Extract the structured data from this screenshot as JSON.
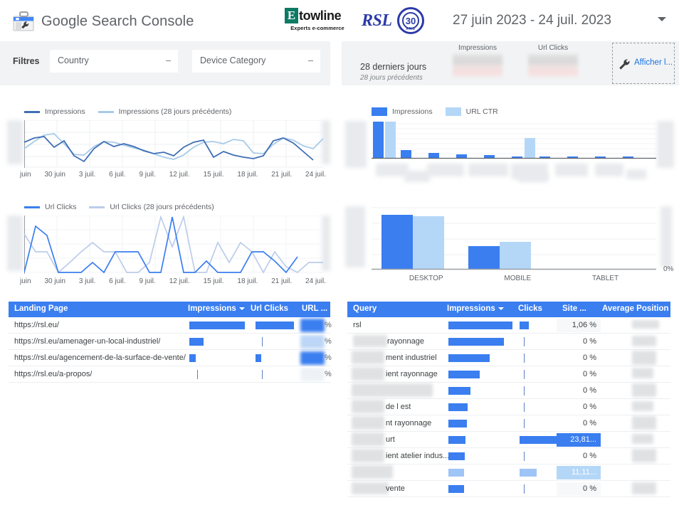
{
  "header": {
    "app_title": "Google Search Console",
    "gsc_icon": "search-console-toolbox-icon",
    "etowline": {
      "mark": "E",
      "word": "towline",
      "tagline": "Experts e-commerce"
    },
    "rsl": {
      "text": "RSL",
      "badge_number": "30",
      "badge_sub": "ANS"
    },
    "date_range": "27 juin 2023 - 24 juil. 2023",
    "date_caret_icon": "chevron-down-icon"
  },
  "filters": {
    "label": "Filtres",
    "selects": [
      {
        "value": "Country",
        "caret_icon": "chevron-down-icon"
      },
      {
        "value": "Device Category",
        "caret_icon": "chevron-down-icon"
      }
    ]
  },
  "kpis": {
    "period": "28 derniers jours",
    "period_prev": "28 jours précédents",
    "cards": [
      {
        "name": "Impressions",
        "value": ""
      },
      {
        "name": "Url Clicks",
        "value": ""
      }
    ],
    "show_button": {
      "label": "Afficher l...",
      "icon": "wrench-icon"
    }
  },
  "chart_data": [
    {
      "id": "impressions-timeseries",
      "type": "line",
      "title": "",
      "legend": [
        {
          "name": "Impressions",
          "color": "#3f6fb5"
        },
        {
          "name": "Impressions (28 jours précédents)",
          "color": "#a8cbe8"
        }
      ],
      "legend_position": "top-left",
      "xlabel": "",
      "ylabel": "",
      "grid": true,
      "ylim": [
        0,
        100
      ],
      "tick_labels": [
        "juin",
        "30 juin",
        "3 juil.",
        "6 juil.",
        "9 juil.",
        "12 juil.",
        "15 juil.",
        "18 juil.",
        "21 juil.",
        "24 juil."
      ],
      "x": [
        0,
        1,
        2,
        3,
        4,
        5,
        6,
        7,
        8,
        9,
        10,
        11,
        12,
        13,
        14,
        15,
        16,
        17,
        18,
        19,
        20,
        21,
        22,
        23,
        24,
        25,
        26,
        27
      ],
      "series": [
        {
          "name": "Impressions",
          "color": "#3f6fb5",
          "values": [
            62,
            70,
            72,
            52,
            66,
            38,
            24,
            46,
            60,
            50,
            56,
            50,
            42,
            38,
            40,
            34,
            52,
            62,
            66,
            30,
            40,
            34,
            30,
            28,
            32,
            62,
            68,
            58,
            40,
            22
          ]
        },
        {
          "name": "Impressions (28 jours précédents)",
          "color": "#a8cbe8",
          "values": [
            50,
            62,
            72,
            74,
            56,
            34,
            32,
            48,
            58,
            56,
            52,
            46,
            42,
            36,
            30,
            26,
            34,
            50,
            60,
            60,
            56,
            64,
            62,
            36,
            34,
            54,
            66,
            62,
            52,
            46,
            62
          ]
        }
      ]
    },
    {
      "id": "urlclicks-timeseries",
      "type": "line",
      "title": "",
      "legend": [
        {
          "name": "Url Clicks",
          "color": "#3a7ef0"
        },
        {
          "name": "Url Clicks (28 jours précédents)",
          "color": "#bcccea"
        }
      ],
      "legend_position": "top-left",
      "xlabel": "",
      "ylabel": "",
      "grid": true,
      "ylim": [
        0,
        100
      ],
      "tick_labels": [
        "juin",
        "30 juin",
        "3 juil.",
        "6 juil.",
        "9 juil.",
        "12 juil.",
        "15 juil.",
        "18 juil.",
        "21 juil.",
        "24 juil."
      ],
      "series": [
        {
          "name": "Url Clicks",
          "color": "#3a7ef0",
          "values": [
            0,
            84,
            70,
            0,
            0,
            0,
            18,
            0,
            36,
            36,
            36,
            0,
            0,
            100,
            0,
            0,
            20,
            0,
            0,
            0,
            36,
            36,
            20,
            0,
            24,
            0
          ]
        },
        {
          "name": "Url Clicks (28 jours précédents)",
          "color": "#bcccea",
          "values": [
            68,
            36,
            36,
            0,
            18,
            36,
            52,
            36,
            36,
            0,
            0,
            20,
            100,
            56,
            100,
            0,
            0,
            52,
            20,
            52,
            36,
            0,
            36,
            10,
            0,
            18
          ]
        }
      ]
    },
    {
      "id": "impressions-ctr-bars",
      "type": "bar",
      "title": "",
      "legend": [
        {
          "name": "Impressions",
          "color": "#3a7ef0"
        },
        {
          "name": "URL CTR",
          "color": "#b4d7f8"
        }
      ],
      "legend_position": "top-left",
      "categories": [
        "1",
        "2",
        "3",
        "4",
        "5",
        "6",
        "7",
        "8",
        "9",
        "10"
      ],
      "grid": true,
      "series": [
        {
          "name": "Impressions",
          "color": "#3a7ef0",
          "values": [
            100,
            22,
            14,
            9,
            6,
            3,
            2.5,
            2,
            2,
            1.5
          ]
        },
        {
          "name": "URL CTR",
          "color": "#b4d7f8",
          "values": [
            100,
            0,
            0,
            0,
            0,
            48,
            0,
            0,
            0,
            0
          ]
        }
      ]
    },
    {
      "id": "device-category-bars",
      "type": "bar",
      "title": "",
      "categories": [
        "DESKTOP",
        "MOBILE",
        "TABLET"
      ],
      "grid": true,
      "axis_right_label": "0%",
      "series": [
        {
          "name": "Impressions",
          "color": "#3a7ef0",
          "values": [
            100,
            33,
            0
          ]
        },
        {
          "name": "URL CTR",
          "color": "#b4d7f8",
          "values": [
            97,
            45,
            0
          ]
        }
      ]
    }
  ],
  "landing_table": {
    "columns": [
      {
        "label": "Landing Page",
        "sorted": false
      },
      {
        "label": "Impressions",
        "sorted": true,
        "caret_icon": "sort-desc-icon"
      },
      {
        "label": "Url Clicks",
        "sorted": false
      },
      {
        "label": "URL ...",
        "sorted": false
      }
    ],
    "rows": [
      {
        "page": "https://rsl.eu/",
        "impressions_w": 68,
        "clicks_w": 58,
        "clicks_tick": false,
        "ctr_suffix": "%"
      },
      {
        "page": "https://rsl.eu/amenager-un-local-industriel/",
        "impressions_w": 18,
        "clicks_w": 0,
        "clicks_tick": true,
        "ctr_suffix": "%"
      },
      {
        "page": "https://rsl.eu/agencement-de-la-surface-de-vente/",
        "impressions_w": 7,
        "clicks_w": 7,
        "clicks_tick": false,
        "ctr_suffix": "%"
      },
      {
        "page": "https://rsl.eu/a-propos/",
        "impressions_w": 0,
        "clicks_w": 0,
        "clicks_tick": true,
        "ctr_suffix": "%"
      }
    ]
  },
  "query_table": {
    "columns": [
      {
        "label": "Query",
        "sorted": false
      },
      {
        "label": "Impressions",
        "sorted": true,
        "caret_icon": "sort-desc-icon"
      },
      {
        "label": "Clicks",
        "sorted": false
      },
      {
        "label": "Site ...",
        "sorted": false
      },
      {
        "label": "Average Position",
        "sorted": false
      }
    ],
    "rows": [
      {
        "query": "rsl",
        "redacted_w": 0,
        "impressions_w": 92,
        "clicks_w": 13,
        "clicks_tick": false,
        "ctr": "1,06 %",
        "ctr_fill": "none"
      },
      {
        "query": "rayonnage",
        "redacted_w": 48,
        "impressions_w": 80,
        "clicks_w": 0,
        "clicks_tick": true,
        "ctr": "0 %",
        "ctr_fill": "none"
      },
      {
        "query": "ment industriel",
        "redacted_w": 44,
        "impressions_w": 58,
        "clicks_w": 0,
        "clicks_tick": true,
        "ctr": "0 %",
        "ctr_fill": "none"
      },
      {
        "query": "ient rayonnage",
        "redacted_w": 44,
        "impressions_w": 44,
        "clicks_w": 0,
        "clicks_tick": true,
        "ctr": "0 %",
        "ctr_fill": "none"
      },
      {
        "query": "",
        "redacted_w": 112,
        "impressions_w": 31,
        "clicks_w": 0,
        "clicks_tick": true,
        "ctr": "0 %",
        "ctr_fill": "none"
      },
      {
        "query": "de l est",
        "redacted_w": 44,
        "impressions_w": 27,
        "clicks_w": 0,
        "clicks_tick": true,
        "ctr": "0 %",
        "ctr_fill": "none"
      },
      {
        "query": "nt rayonnage",
        "redacted_w": 44,
        "impressions_w": 26,
        "clicks_w": 0,
        "clicks_tick": true,
        "ctr": "0 %",
        "ctr_fill": "none"
      },
      {
        "query": "urt",
        "redacted_w": 44,
        "impressions_w": 24,
        "clicks_w": 53,
        "clicks_tick": false,
        "ctr": "23,81...",
        "ctr_fill": "solid"
      },
      {
        "query": "ient atelier indus...",
        "redacted_w": 44,
        "impressions_w": 23,
        "clicks_w": 0,
        "clicks_tick": true,
        "ctr": "0 %",
        "ctr_fill": "none"
      },
      {
        "query": "",
        "redacted_w": 56,
        "impressions_w": 22,
        "clicks_w": 24,
        "clicks_tick": false,
        "ctr": "11,11...",
        "ctr_fill": "light"
      },
      {
        "query": "vente",
        "redacted_w": 48,
        "impressions_w": 22,
        "clicks_w": 0,
        "clicks_tick": true,
        "ctr": "0 %",
        "ctr_fill": "none"
      }
    ]
  },
  "colors": {
    "accent_blue": "#3a7ef0",
    "light_blue": "#b4d7f8",
    "header_blue": "#3a7ef0",
    "line_dark": "#3f6fb5",
    "line_light": "#a8cbe8",
    "grey_bg": "#f1f3f4",
    "text_grey": "#5f6368",
    "link_blue": "#1a73e8"
  }
}
